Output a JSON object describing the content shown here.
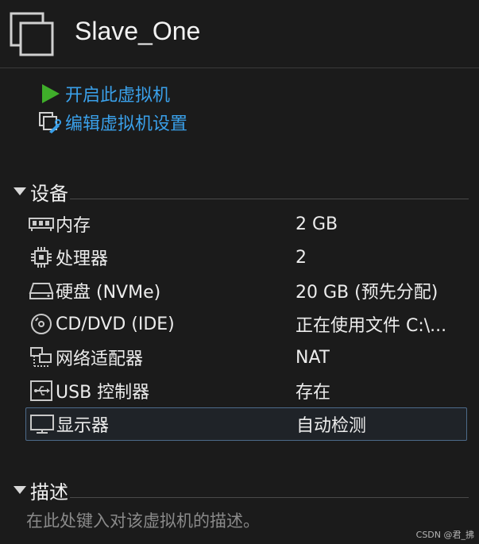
{
  "vm": {
    "title": "Slave_One"
  },
  "actions": [
    {
      "label": "开启此虚拟机",
      "icon": "play-icon"
    },
    {
      "label": "编辑虚拟机设置",
      "icon": "edit-settings-icon"
    }
  ],
  "devices_section": {
    "label": "设备"
  },
  "devices": [
    {
      "name": "内存",
      "value": "2 GB",
      "icon": "memory-icon"
    },
    {
      "name": "处理器",
      "value": "2",
      "icon": "processor-icon"
    },
    {
      "name": "硬盘 (NVMe)",
      "value": "20 GB (预先分配)",
      "icon": "hard-disk-icon"
    },
    {
      "name": "CD/DVD (IDE)",
      "value": "正在使用文件 C:\\...",
      "icon": "cd-dvd-icon"
    },
    {
      "name": "网络适配器",
      "value": "NAT",
      "icon": "network-adapter-icon"
    },
    {
      "name": "USB 控制器",
      "value": "存在",
      "icon": "usb-icon"
    },
    {
      "name": "显示器",
      "value": "自动检测",
      "icon": "display-icon",
      "selected": true
    }
  ],
  "description_section": {
    "label": "描述",
    "placeholder": "在此处键入对该虚拟机的描述。"
  },
  "watermark": "CSDN @君_拂",
  "colors": {
    "link": "#3aa0ea",
    "play": "#3fae2a",
    "background": "#1b1b1b",
    "selection_border": "#4d6b8a"
  }
}
